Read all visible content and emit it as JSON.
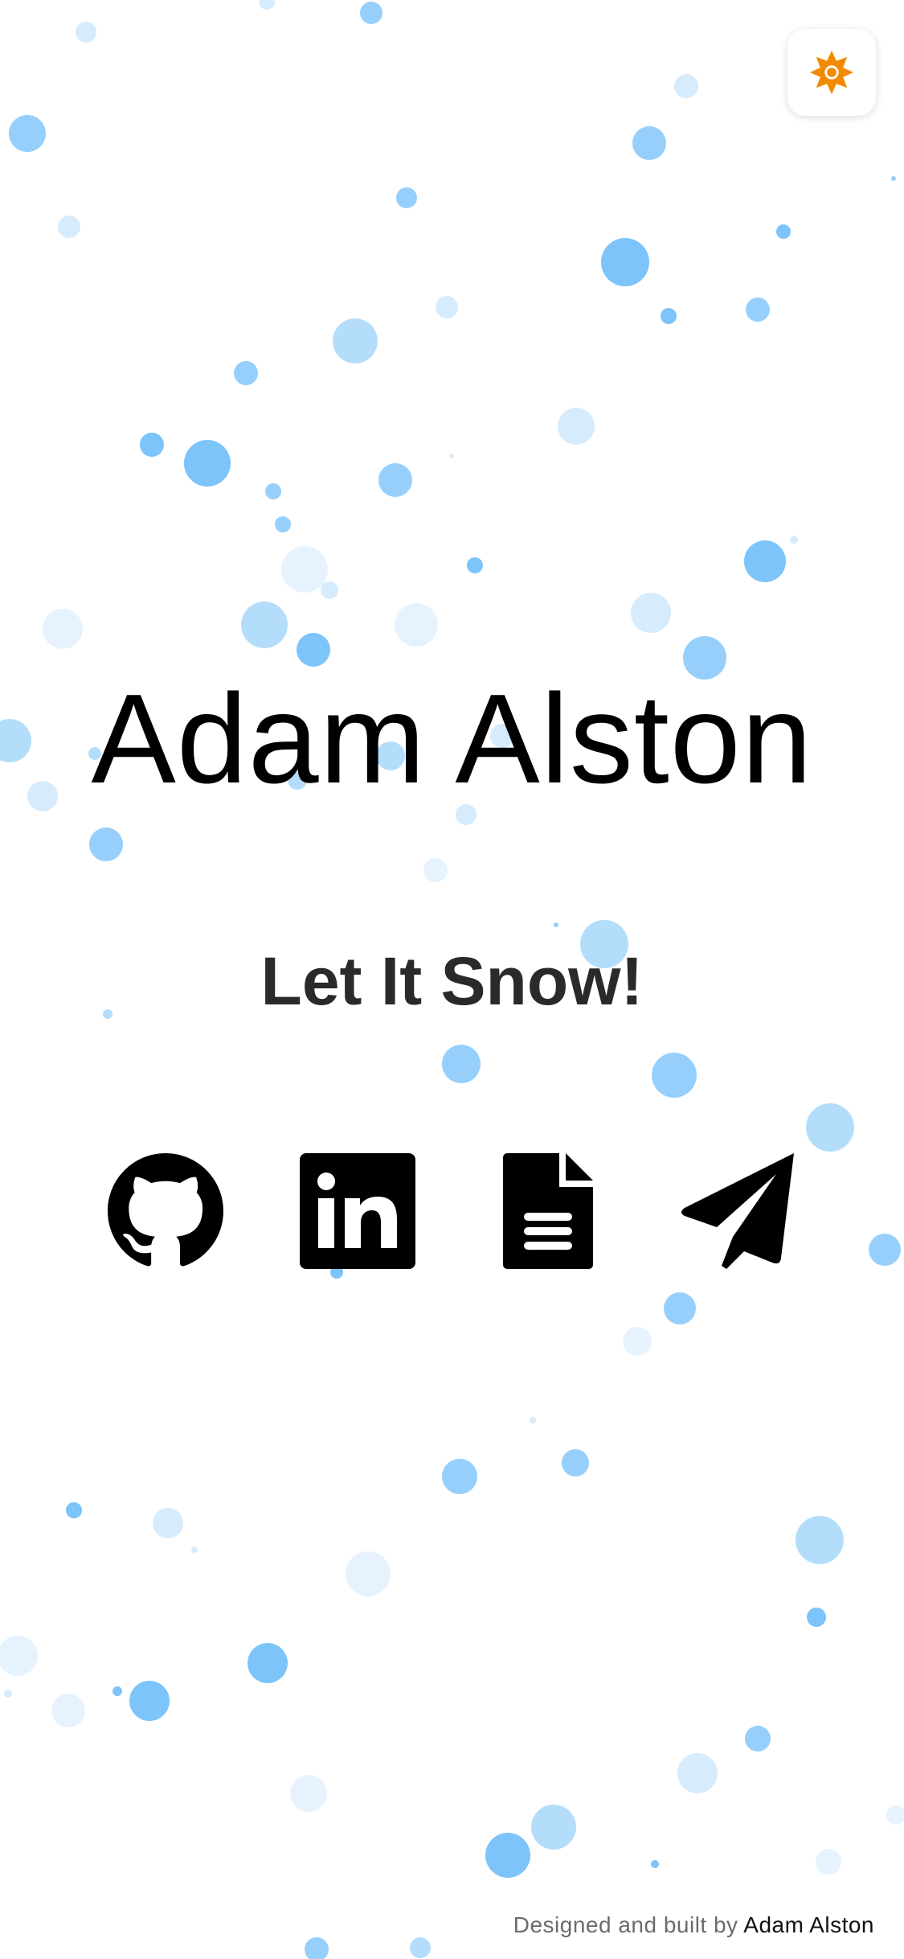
{
  "app": {
    "title": "Adam Alston",
    "subtitle": "Let It Snow!"
  },
  "theme_toggle": {
    "icon": "sun-icon",
    "accent_color": "#F28A00"
  },
  "social_links": [
    {
      "name": "github",
      "icon": "github-icon"
    },
    {
      "name": "linkedin",
      "icon": "linkedin-icon"
    },
    {
      "name": "resume",
      "icon": "document-icon"
    },
    {
      "name": "contact",
      "icon": "paper-plane-icon"
    }
  ],
  "footer": {
    "prefix": "Designed and built by",
    "author": "Adam Alston"
  },
  "colors": {
    "background": "#FFFFFF",
    "snow_primary": "#7CC4FA",
    "text": "#000000",
    "footer_text": "#6B6B6B"
  }
}
